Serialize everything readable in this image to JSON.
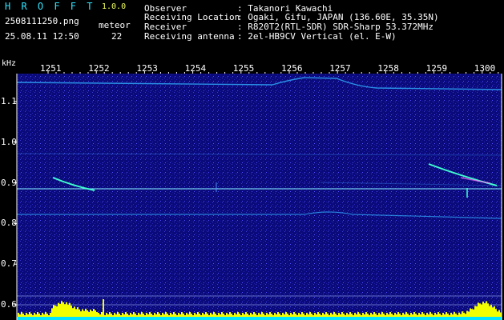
{
  "app": {
    "name": "H R O F F T",
    "version": "1.0.0"
  },
  "file": {
    "name": "2508111250.png",
    "datetime": "25.08.11 12:50"
  },
  "meteor": {
    "label": "meteor",
    "count": "22"
  },
  "info": {
    "observer_label": "Observer",
    "observer_value": ": Takanori Kawachi",
    "location_label": "Receiving Location",
    "location_value": ": Ogaki, Gifu, JAPAN (136.60E, 35.35N)",
    "receiver_label": "Receiver",
    "receiver_value": ": R820T2(RTL-SDR) SDR-Sharp 53.372MHz",
    "antenna_label": "Receiving antenna",
    "antenna_value": ": 2el-HB9CV Vertical (el. E-W)"
  },
  "axis": {
    "unit_label": "kHz",
    "time_ticks": [
      "1251",
      "1252",
      "1253",
      "1254",
      "1255",
      "1256",
      "1257",
      "1258",
      "1259",
      "1300"
    ],
    "freq_ticks": [
      "1.1",
      "1.0",
      "0.9",
      "0.8",
      "0.7",
      "0.6"
    ]
  },
  "colors": {
    "background": "#0a0a7a",
    "header_text": "#32e6ff",
    "version_text": "#f2ff5a",
    "echo": "#40ffd0",
    "histogram": "#f2ff00",
    "histogram_base": "#00e5ff"
  }
}
